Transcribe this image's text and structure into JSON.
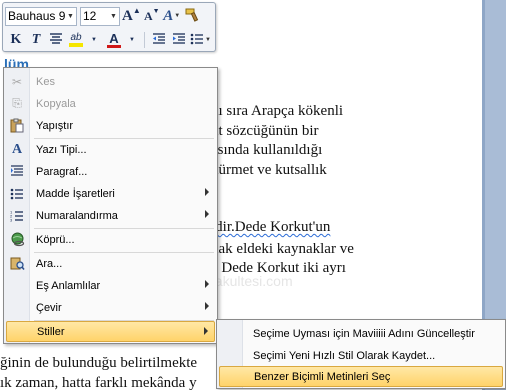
{
  "document": {
    "heading": "lüm",
    "lines": [
      "nı sıra Arapça kökenli",
      "ut sözcüğünün bir",
      "asında kullanıldığı",
      "hürmet ve kutsallık",
      "ldir.Dede Korkut'un",
      "nak eldeki kaynaklar ve",
      "e Dede Korkut iki ayrı",
      "ğinin de bulunduğu belirtilmekte",
      "ık zaman, hatta farklı mekânda y"
    ],
    "watermark": "edebiyatfakultesi.com"
  },
  "mini_toolbar": {
    "font_name": "Bauhaus 9:",
    "font_size": "12",
    "grow_font": "A",
    "shrink_font": "A",
    "styles_glyph": "A",
    "bold": "K",
    "italic": "T",
    "highlight_glyph": "ab",
    "font_color_glyph": "A",
    "colors": {
      "highlight": "#f5e600",
      "font_color": "#d01818"
    }
  },
  "context_menu": {
    "items": [
      {
        "label": "Kes",
        "icon": "scissors-icon",
        "glyph": "✂",
        "enabled": false,
        "submenu": false
      },
      {
        "label": "Kopyala",
        "icon": "copy-icon",
        "glyph": "⎘",
        "enabled": false,
        "submenu": false
      },
      {
        "label": "Yapıştır",
        "icon": "paste-icon",
        "glyph": "📋",
        "enabled": true,
        "submenu": false
      },
      {
        "label": "Yazı Tipi...",
        "icon": "font-icon",
        "glyph": "A",
        "enabled": true,
        "submenu": false
      },
      {
        "label": "Paragraf...",
        "icon": "paragraph-icon",
        "glyph": "¶",
        "enabled": true,
        "submenu": false
      },
      {
        "label": "Madde İşaretleri",
        "icon": "bullets-icon",
        "glyph": "☰",
        "enabled": true,
        "submenu": true
      },
      {
        "label": "Numaralandırma",
        "icon": "numbering-icon",
        "glyph": "☷",
        "enabled": true,
        "submenu": true
      },
      {
        "label": "Köprü...",
        "icon": "hyperlink-icon",
        "glyph": "🌐",
        "enabled": true,
        "submenu": false
      },
      {
        "label": "Ara...",
        "icon": "research-icon",
        "glyph": "🔍",
        "enabled": true,
        "submenu": false
      },
      {
        "label": "Eş Anlamlılar",
        "icon": "",
        "glyph": "",
        "enabled": true,
        "submenu": true
      },
      {
        "label": "Çevir",
        "icon": "",
        "glyph": "",
        "enabled": true,
        "submenu": true
      },
      {
        "label": "Stiller",
        "icon": "",
        "glyph": "",
        "enabled": true,
        "submenu": true,
        "active": true
      }
    ]
  },
  "styles_submenu": {
    "items": [
      {
        "label": "Seçime Uyması için Maviiiii Adını Güncelleştir"
      },
      {
        "label": "Seçimi Yeni Hızlı Stil Olarak Kaydet..."
      },
      {
        "label": "Benzer Biçimli Metinleri Seç",
        "active": true
      }
    ]
  }
}
